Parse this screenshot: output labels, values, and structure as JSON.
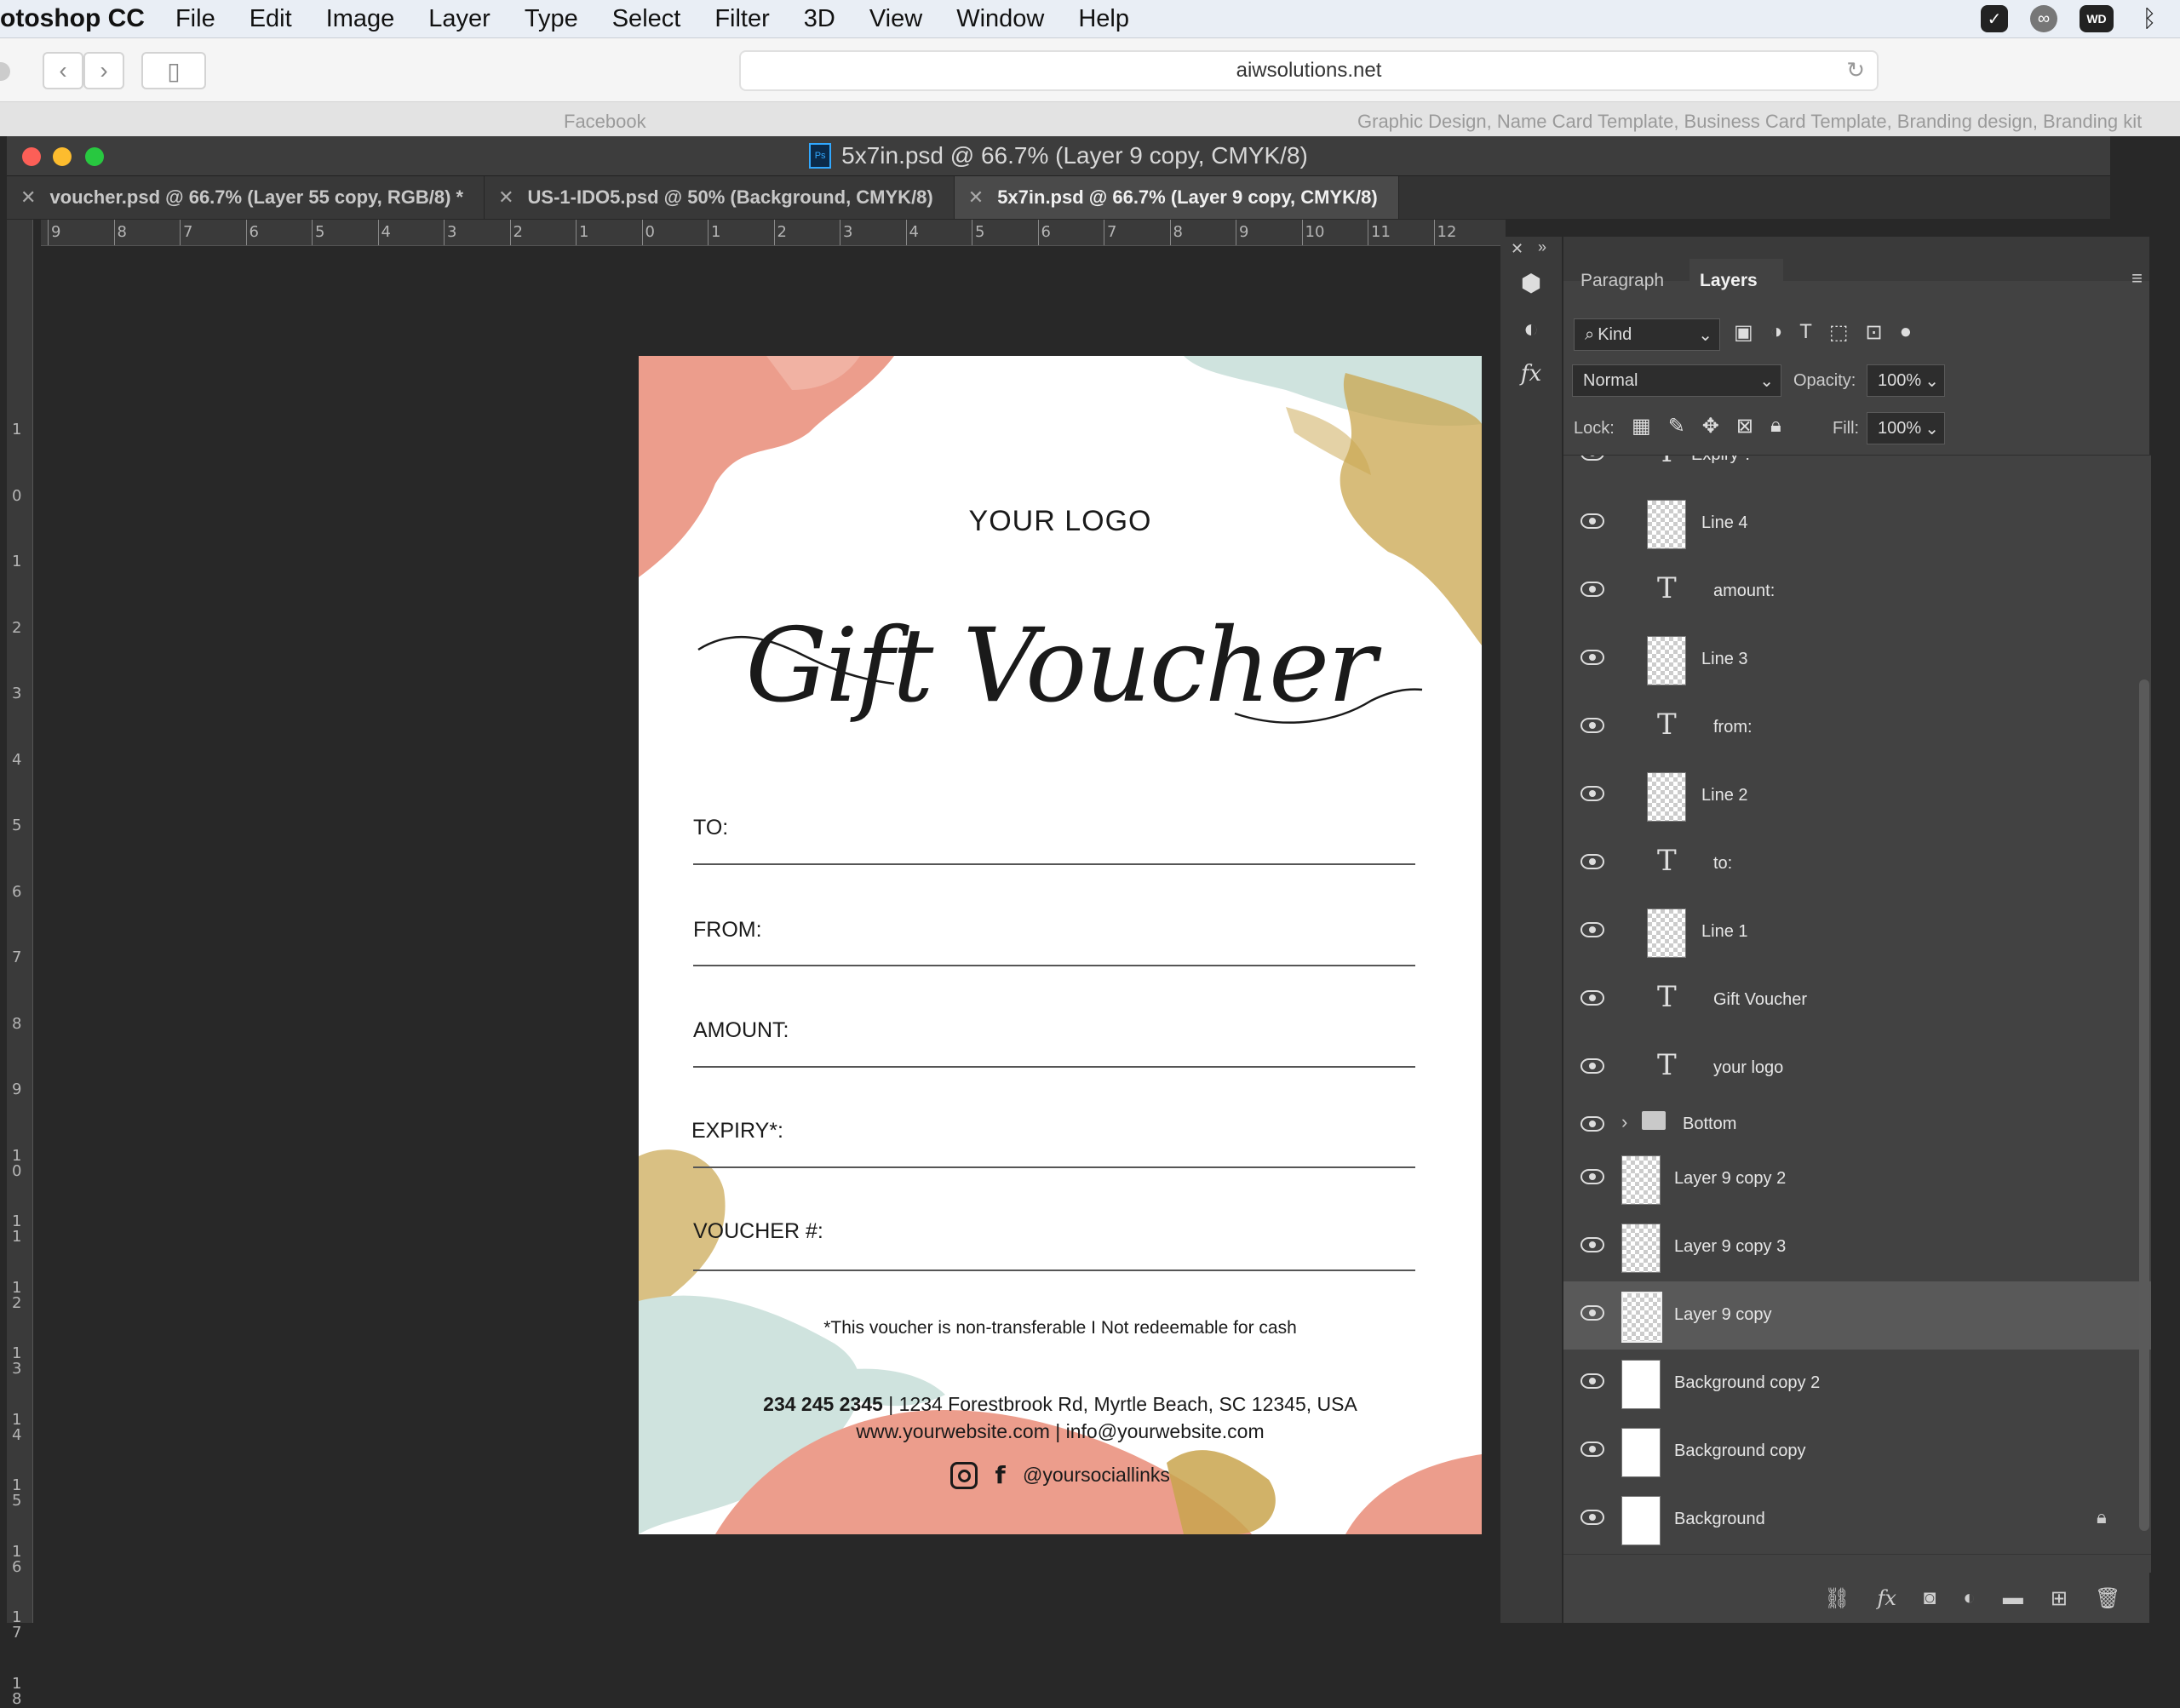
{
  "menubar": {
    "app": "otoshop CC",
    "items": [
      "File",
      "Edit",
      "Image",
      "Layer",
      "Type",
      "Select",
      "Filter",
      "3D",
      "View",
      "Window",
      "Help"
    ]
  },
  "browser": {
    "url": "aiwsolutions.net",
    "tab_left": "Facebook",
    "tab_right": "Graphic Design, Name Card Template, Business Card Template, Branding design, Branding kit"
  },
  "window": {
    "title": "5x7in.psd @ 66.7% (Layer 9 copy, CMYK/8)",
    "tabs": [
      {
        "label": "voucher.psd @ 66.7% (Layer 55 copy, RGB/8) *"
      },
      {
        "label": "US-1-IDO5.psd @ 50% (Background, CMYK/8)"
      },
      {
        "label": "5x7in.psd @ 66.7% (Layer 9 copy, CMYK/8)"
      }
    ]
  },
  "ruler_top": [
    "9",
    "8",
    "7",
    "6",
    "5",
    "4",
    "3",
    "2",
    "1",
    "0",
    "1",
    "2",
    "3",
    "4",
    "5",
    "6",
    "7",
    "8",
    "9",
    "10",
    "11",
    "12"
  ],
  "ruler_left": [
    "1",
    "0",
    "1",
    "2",
    "3",
    "4",
    "5",
    "6",
    "7",
    "8",
    "9",
    "1 0",
    "1 1",
    "1 2",
    "1 3",
    "1 4",
    "1 5",
    "1 6",
    "1 7",
    "1 8"
  ],
  "voucher": {
    "logo": "YOUR LOGO",
    "title": "Gift Voucher",
    "fields": [
      "TO:",
      "FROM:",
      "AMOUNT:",
      "EXPIRY*:",
      "VOUCHER #:"
    ],
    "note": "*This voucher is non-transferable I Not redeemable for cash",
    "phone": "234 245 2345",
    "address": "| 1234 Forestbrook Rd, Myrtle Beach, SC 12345, USA",
    "web": "www.yourwebsite.com | info@yourwebsite.com",
    "social": "@yoursociallinks"
  },
  "panel": {
    "tabs": [
      "Paragraph",
      "Layers"
    ],
    "filter": "Kind",
    "blend": "Normal",
    "opacity_label": "Opacity:",
    "opacity": "100%",
    "lock_label": "Lock:",
    "fill_label": "Fill:",
    "fill": "100%",
    "partial_top": "Expiry*:",
    "layers": [
      {
        "name": "Line 4",
        "type": "shape"
      },
      {
        "name": "amount:",
        "type": "text"
      },
      {
        "name": "Line 3",
        "type": "shape"
      },
      {
        "name": "from:",
        "type": "text"
      },
      {
        "name": "Line 2",
        "type": "shape"
      },
      {
        "name": "to:",
        "type": "text"
      },
      {
        "name": "Line 1",
        "type": "shape"
      },
      {
        "name": "Gift Voucher",
        "type": "text"
      },
      {
        "name": "your logo",
        "type": "text"
      },
      {
        "name": "Bottom",
        "type": "group"
      },
      {
        "name": "Layer 9 copy 2",
        "type": "pixel"
      },
      {
        "name": "Layer 9 copy 3",
        "type": "pixel"
      },
      {
        "name": "Layer 9 copy",
        "type": "pixel",
        "selected": true
      },
      {
        "name": "Background copy 2",
        "type": "white"
      },
      {
        "name": "Background copy",
        "type": "white"
      },
      {
        "name": "Background",
        "type": "white",
        "locked": true
      }
    ]
  },
  "colors": {
    "coral": "#ec9d8c",
    "mint": "#c9e1dc",
    "gold": "#c9a54e",
    "selected": "#595959"
  }
}
